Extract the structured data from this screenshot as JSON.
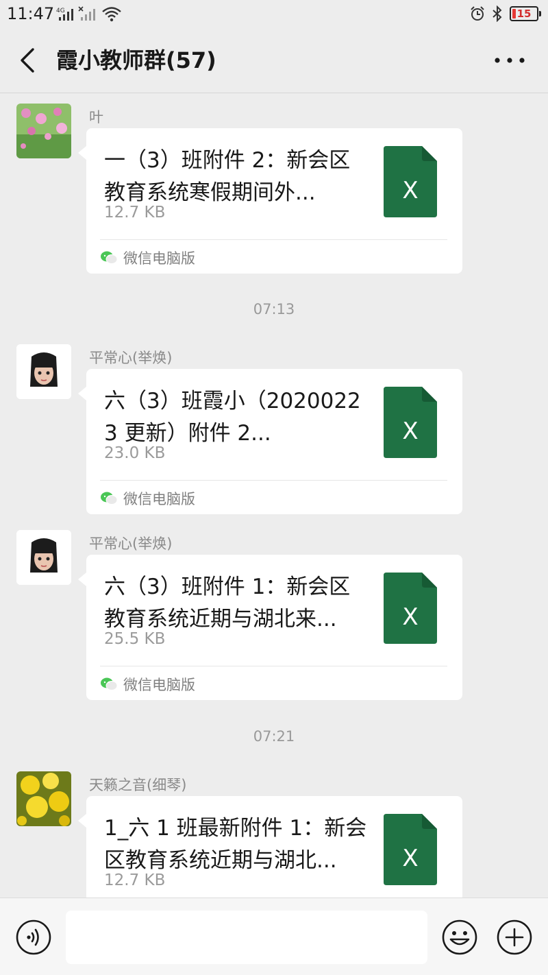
{
  "status_bar": {
    "time": "11:47",
    "network_label": "4G",
    "battery_level": "15",
    "battery_fraction": 0.15,
    "icons": [
      "signal-icon",
      "alarm-icon",
      "bluetooth-icon",
      "battery-icon"
    ]
  },
  "header": {
    "title": "霞小教师群(57)",
    "back_icon": "chevron-left-icon",
    "more_icon": "more-dots-icon"
  },
  "messages": [
    {
      "sender": "叶",
      "avatar": "flowers-photo",
      "file_name": "一（3）班附件 2：新会区教育系统寒假期间外...",
      "file_size": "12.7 KB",
      "source": "微信电脑版"
    },
    {
      "timestamp": "07:13"
    },
    {
      "sender": "平常心(举焕)",
      "avatar": "cartoon-girl",
      "file_name": "六（3）班霞小（20200223 更新）附件 2...",
      "file_size": "23.0 KB",
      "source": "微信电脑版"
    },
    {
      "sender": "平常心(举焕)",
      "avatar": "cartoon-girl",
      "file_name": "六（3）班附件 1：新会区教育系统近期与湖北来...",
      "file_size": "25.5 KB",
      "source": "微信电脑版"
    },
    {
      "timestamp": "07:21"
    },
    {
      "sender": "天籁之音(细琴)",
      "avatar": "yellow-flower-photo",
      "file_name": "1_六 1 班最新附件 1：新会区教育系统近期与湖北...",
      "file_size": "12.7 KB",
      "source": ""
    }
  ],
  "input_bar": {
    "text_value": "",
    "icons": [
      "voice-icon",
      "emoji-icon",
      "plus-icon"
    ]
  },
  "colors": {
    "background": "#ededed",
    "bubble": "#ffffff",
    "excel_green": "#1f7244"
  }
}
